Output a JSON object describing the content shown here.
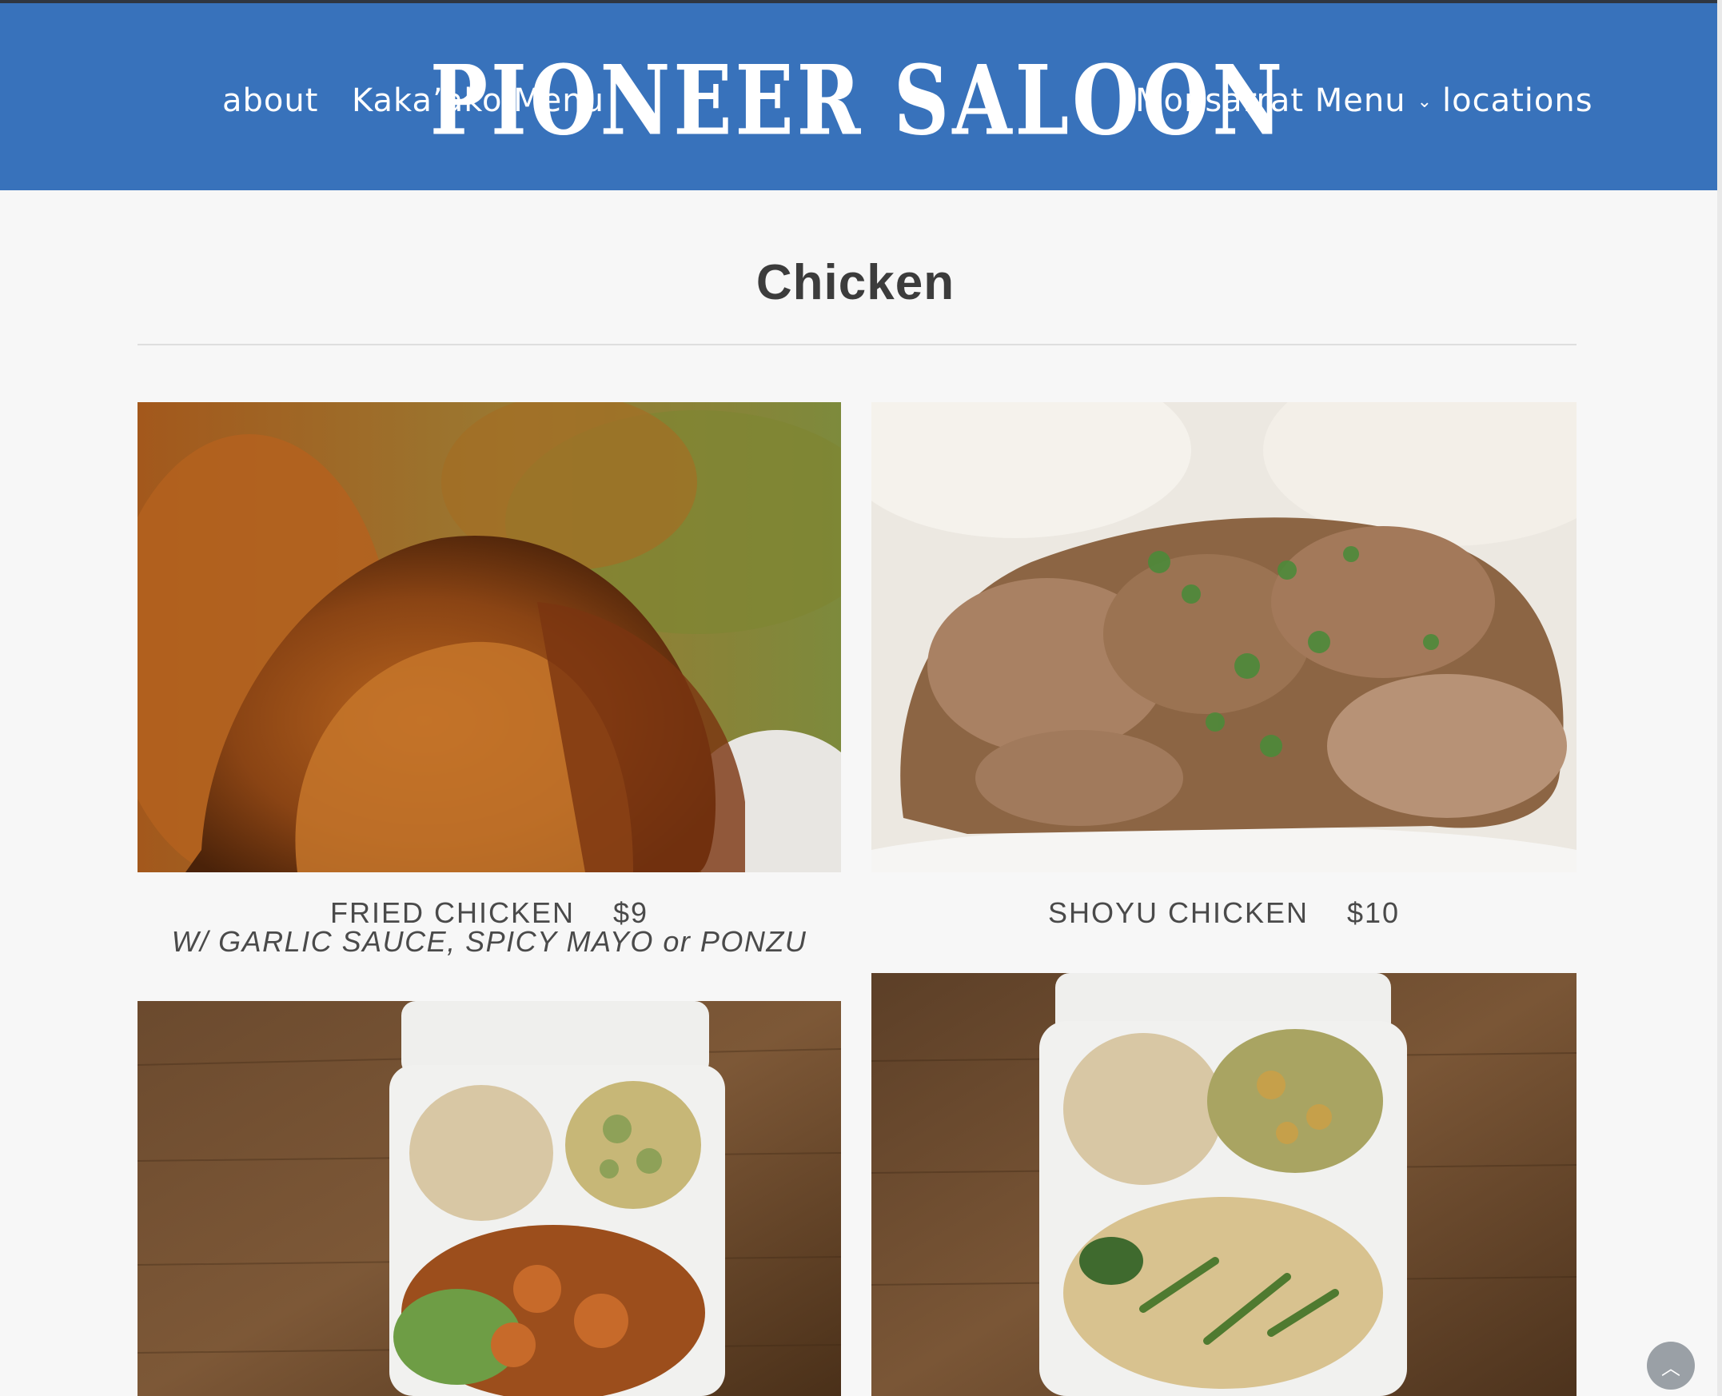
{
  "header": {
    "logo_text": "PIONEER SALOON",
    "nav": {
      "about": "about",
      "kakaako": "Kaka’ako Menu",
      "monsarrat": "Monsarrat Menu",
      "locations": "locations"
    },
    "colors": {
      "background": "#3872bb",
      "text": "#ffffff"
    }
  },
  "section": {
    "title": "Chicken"
  },
  "menu_items": [
    {
      "name": "FRIED CHICKEN",
      "price": "$9",
      "subtitle": "W/ GARLIC SAUCE, SPICY MAYO or PONZU"
    },
    {
      "name": "SHOYU CHICKEN",
      "price": "$10"
    }
  ],
  "icons": {
    "dropdown": "chevron-down-icon",
    "scroll_top": "chevron-up-icon"
  }
}
